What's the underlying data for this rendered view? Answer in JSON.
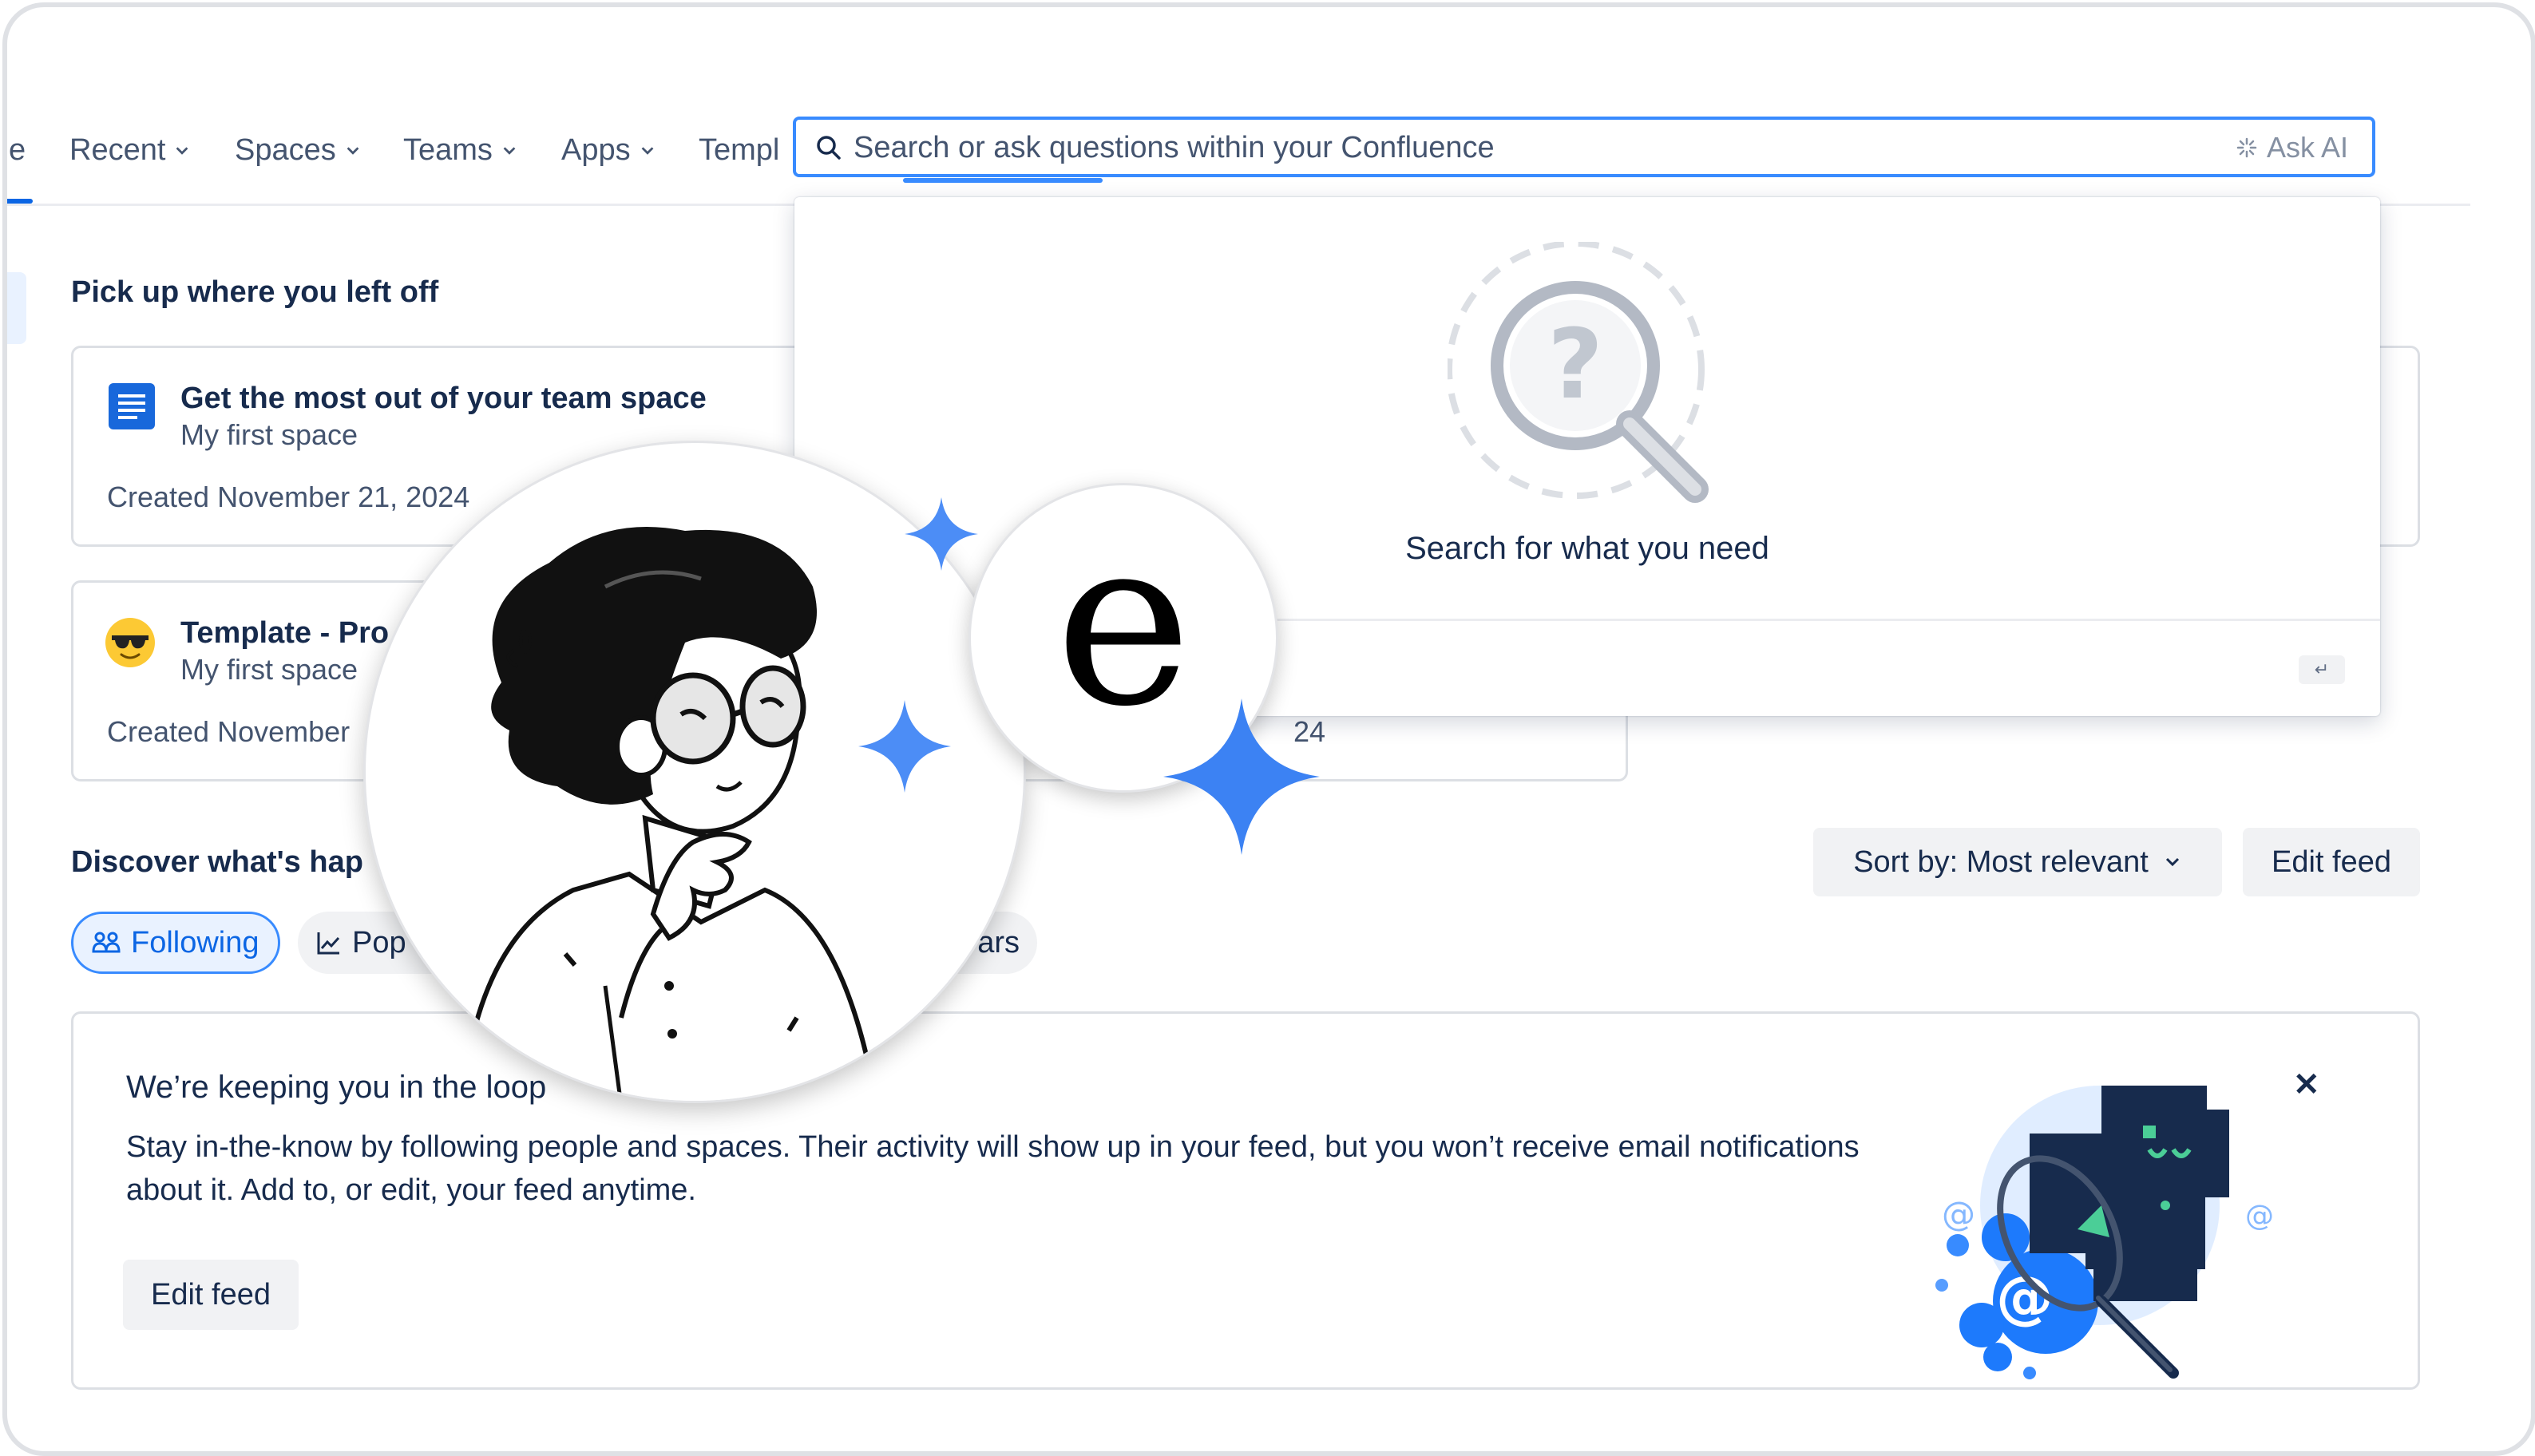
{
  "nav": {
    "partial_left": "e",
    "items": [
      {
        "label": "Recent"
      },
      {
        "label": "Spaces"
      },
      {
        "label": "Teams"
      },
      {
        "label": "Apps"
      }
    ],
    "partial_templates": "Templ"
  },
  "search": {
    "placeholder": "Search or ask questions within your Confluence",
    "ask_ai_label": "Ask AI",
    "empty_message": "Search for what you need",
    "enter_key": "↵"
  },
  "recent": {
    "heading": "Pick up where you left off",
    "cards": [
      {
        "title": "Get the most out of your team space",
        "space": "My first space",
        "meta": "Created November 21, 2024"
      },
      {
        "title": "Template - Pro",
        "space": "My first space",
        "meta": "Created November"
      }
    ],
    "partial_right_meta": "24"
  },
  "discover": {
    "heading": "Discover what's hap",
    "sort_label": "Sort by: Most relevant",
    "edit_feed_label": "Edit feed",
    "tabs": [
      {
        "label": "Following",
        "active": true
      },
      {
        "label": "Pop"
      },
      {
        "label": "ars"
      }
    ]
  },
  "loop_banner": {
    "title": "We’re keeping you in the loop",
    "body": "Stay in-the-know by following people and spaces. Their activity will show up in your feed, but you won’t receive email notifications about it. Add to, or edit, your feed anytime.",
    "button_label": "Edit feed",
    "close_glyph": "✕"
  },
  "overlay": {
    "logo_letter": "e"
  },
  "colors": {
    "accent": "#0c66e4",
    "focus_border": "#388bff",
    "text": "#172b4d",
    "subtle_text": "#44546f",
    "button_bg": "#f1f2f4",
    "sparkle": "#4c8df6"
  }
}
